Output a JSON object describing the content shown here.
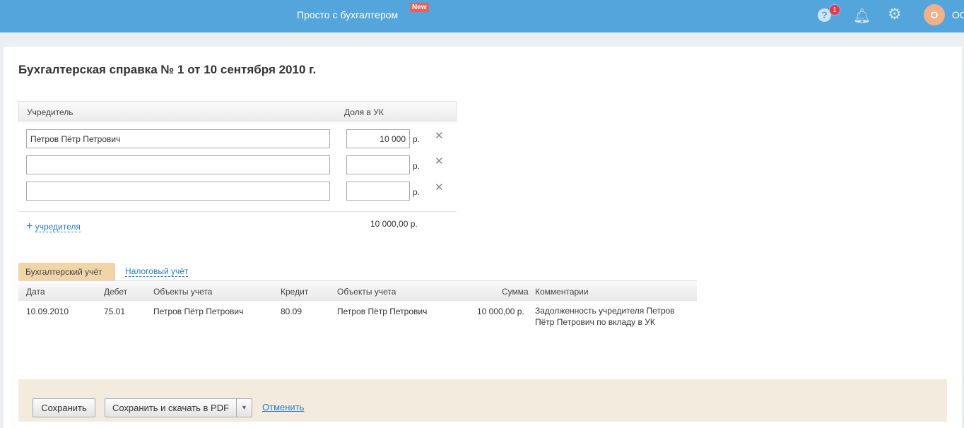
{
  "header": {
    "brand": "Просто с бухгалтером",
    "new_badge": "New",
    "help_count": "1",
    "avatar_letter": "О",
    "user": "ОО"
  },
  "page": {
    "title": "Бухгалтерская справка № 1 от 10 сентября 2010 г."
  },
  "founders": {
    "col_founder": "Учредитель",
    "col_share": "Доля в УК",
    "currency": "р.",
    "rows": [
      {
        "name": "Петров Пётр Петрович",
        "amount": "10 000"
      },
      {
        "name": "",
        "amount": ""
      },
      {
        "name": "",
        "amount": ""
      }
    ],
    "add_label": "учредителя",
    "total": "10 000,00 р."
  },
  "tabs": {
    "accounting": "Бухгалтерский учёт",
    "tax": "Налоговый учёт"
  },
  "entries": {
    "headers": [
      "Дата",
      "Дебет",
      "Объекты учета",
      "Кредит",
      "Объекты учета",
      "Сумма",
      "Комментарии"
    ],
    "rows": [
      [
        "10.09.2010",
        "75.01",
        "Петров Пётр Петрович",
        "80.09",
        "Петров Пётр Петрович",
        "10 000,00 р.",
        "Задолженность учредителя Петров Пётр Петрович по вкладу в УК"
      ]
    ]
  },
  "footer": {
    "save": "Сохранить",
    "save_pdf": "Сохранить и скачать в PDF",
    "cancel": "Отменить"
  }
}
